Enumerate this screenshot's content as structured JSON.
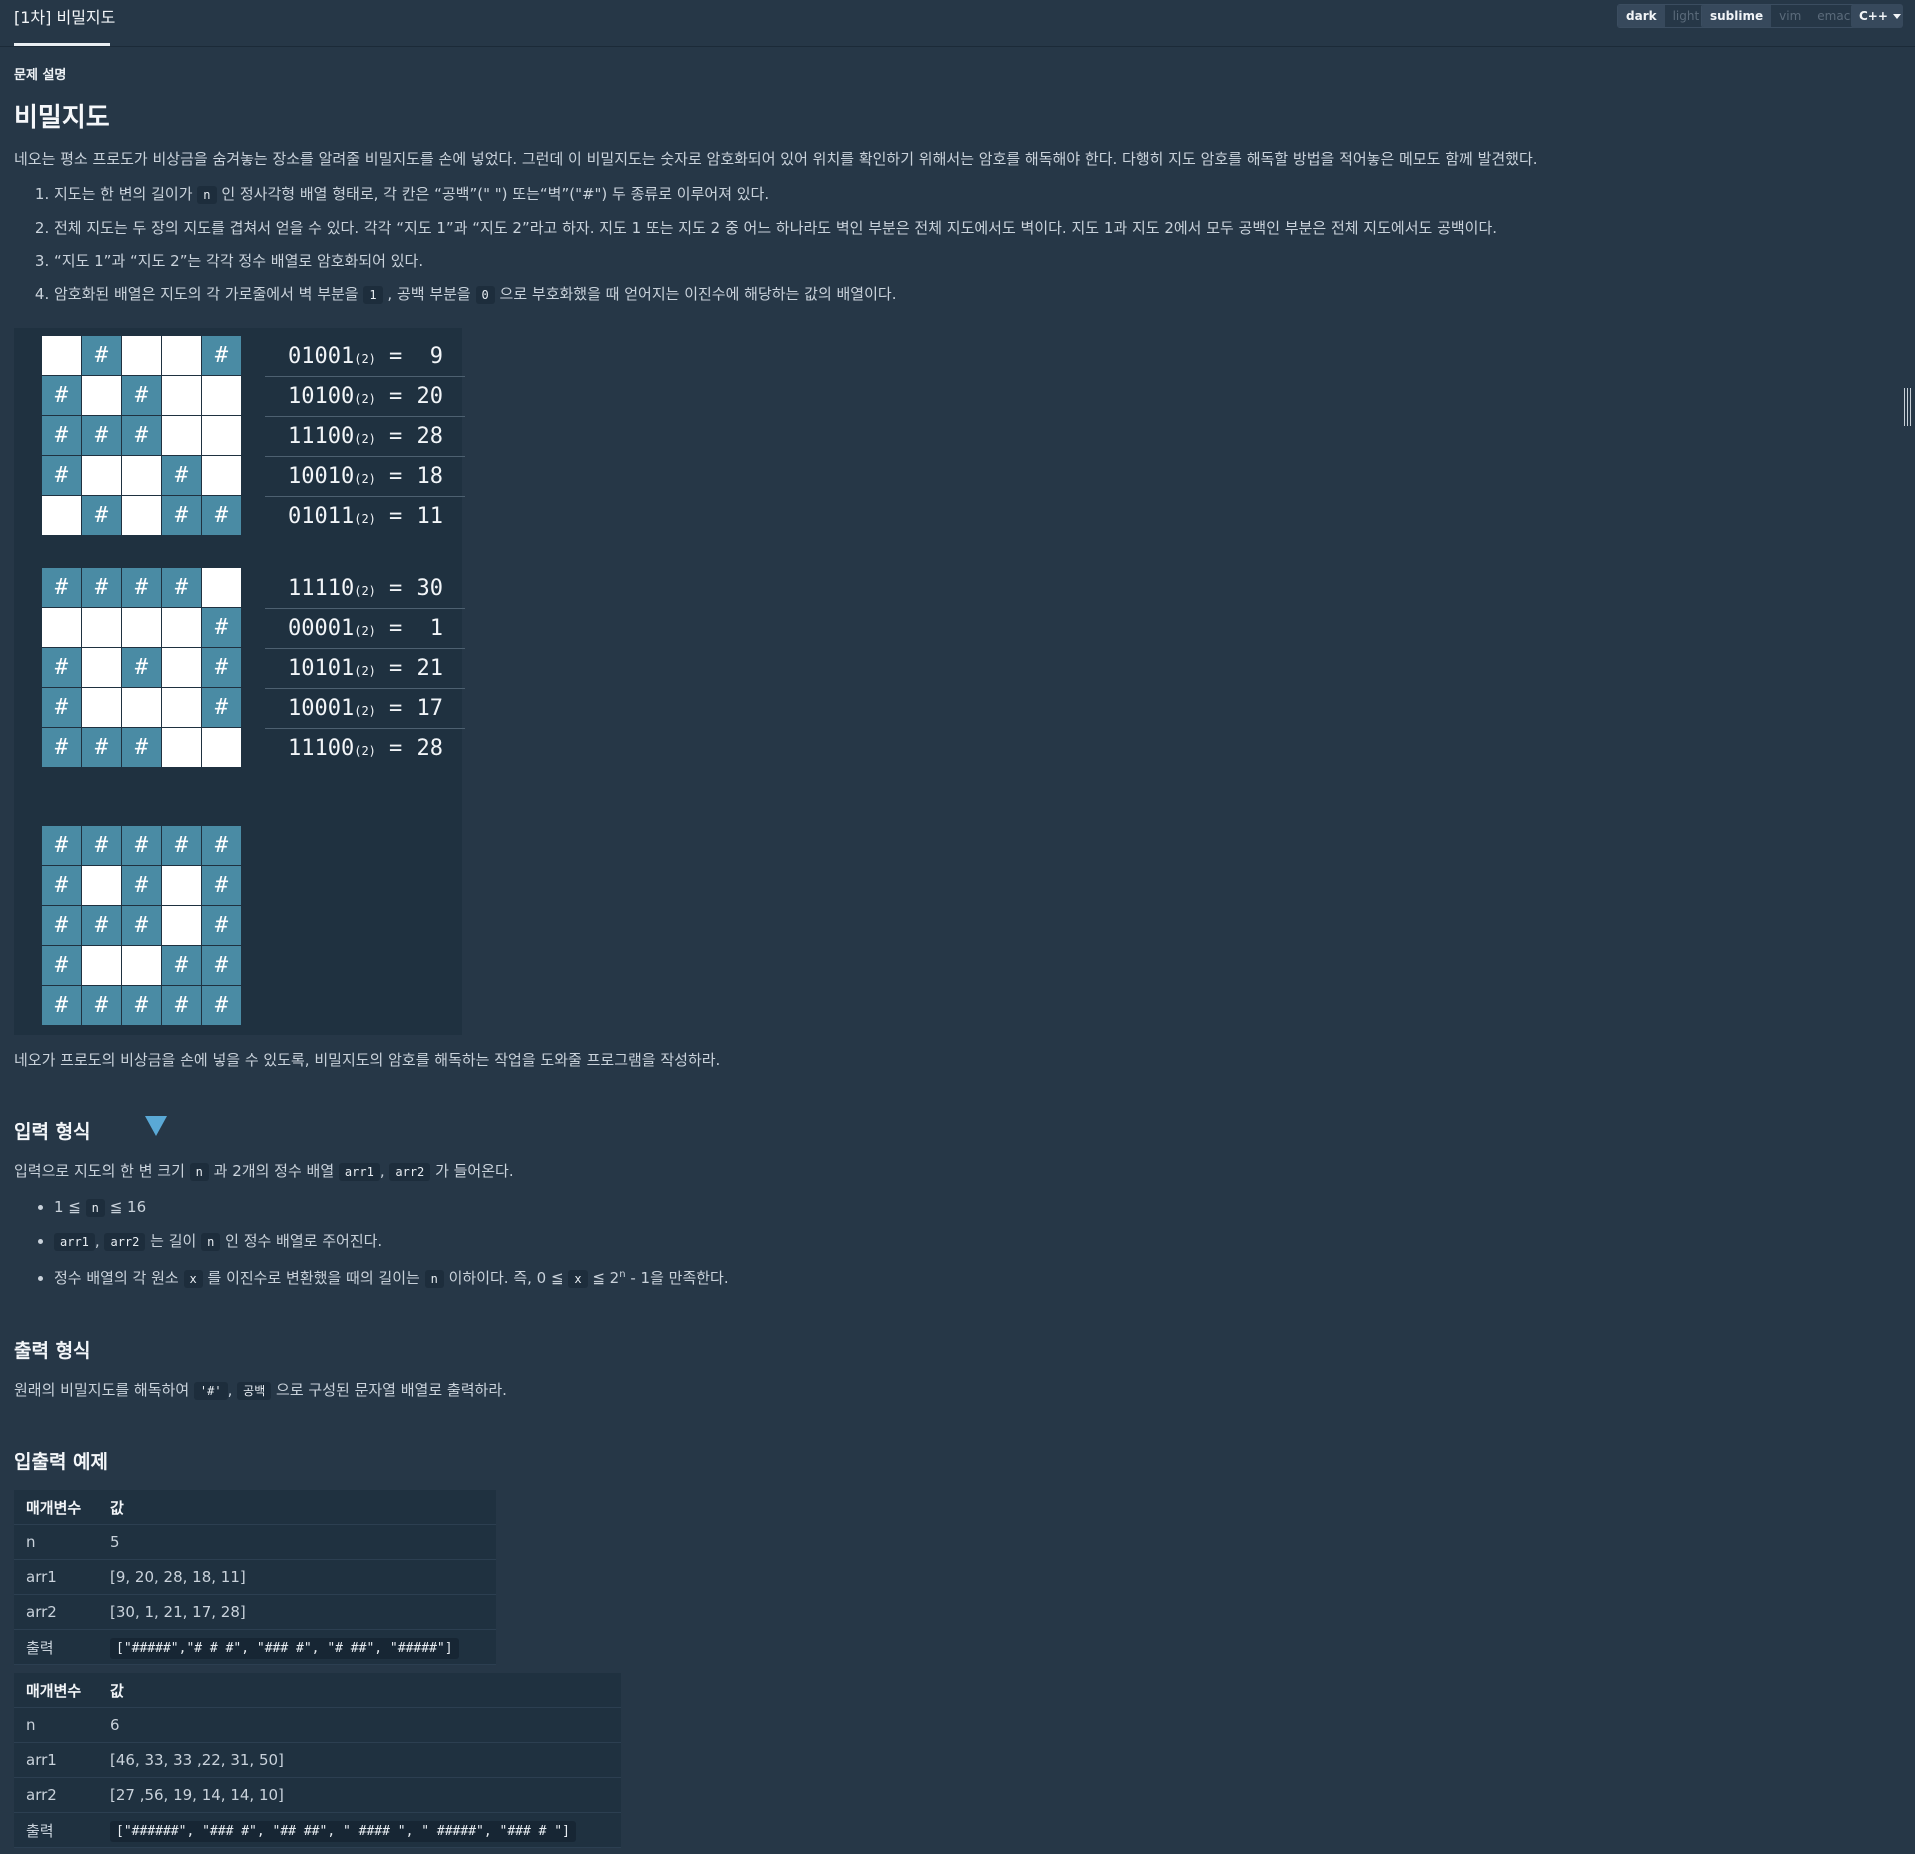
{
  "header": {
    "tab_title": "[1차] 비밀지도",
    "theme_options": [
      "dark",
      "light"
    ],
    "theme_selected": "dark",
    "keymap_options": [
      "sublime",
      "vim",
      "emacs"
    ],
    "keymap_selected": "sublime",
    "language": "C++"
  },
  "problem": {
    "section_label": "문제 설명",
    "title": "비밀지도",
    "intro": "네오는 평소 프로도가 비상금을 숨겨놓는 장소를 알려줄 비밀지도를 손에 넣었다. 그런데 이 비밀지도는 숫자로 암호화되어 있어 위치를 확인하기 위해서는 암호를 해독해야 한다. 다행히 지도 암호를 해독할 방법을 적어놓은 메모도 함께 발견했다.",
    "rules": {
      "r1_a": "지도는 한 변의 길이가",
      "r1_code": "n",
      "r1_b": "인 정사각형 배열 형태로, 각 칸은 “공백”(\" \") 또는“벽”(\"#\") 두 종류로 이루어져 있다.",
      "r2": "전체 지도는 두 장의 지도를 겹쳐서 얻을 수 있다. 각각 “지도 1”과 “지도 2”라고 하자. 지도 1 또는 지도 2 중 어느 하나라도 벽인 부분은 전체 지도에서도 벽이다. 지도 1과 지도 2에서 모두 공백인 부분은 전체 지도에서도 공백이다.",
      "r3": "“지도 1”과 “지도 2”는 각각 정수 배열로 암호화되어 있다.",
      "r4_a": "암호화된 배열은 지도의 각 가로줄에서 벽 부분을",
      "r4_code1": "1",
      "r4_b": ", 공백 부분을",
      "r4_code2": "0",
      "r4_c": "으로 부호화했을 때 얻어지는 이진수에 해당하는 값의 배열이다."
    },
    "figure": {
      "map1": [
        "01001",
        "10100",
        "11100",
        "10010",
        "01011"
      ],
      "map1_values": [
        "9",
        "20",
        "28",
        "18",
        "11"
      ],
      "map2": [
        "11110",
        "00001",
        "10101",
        "10001",
        "11100"
      ],
      "map2_values": [
        "30",
        "1",
        "21",
        "17",
        "28"
      ],
      "result": [
        "11111",
        "10101",
        "11101",
        "10011",
        "11111"
      ],
      "wall_symbol": "#",
      "base_label": "(2)",
      "equals": "="
    },
    "conclusion": "네오가 프로도의 비상금을 손에 넣을 수 있도록, 비밀지도의 암호를 해독하는 작업을 도와줄 프로그램을 작성하라."
  },
  "input_format": {
    "title": "입력 형식",
    "desc_a": "입력으로 지도의 한 변 크기",
    "desc_code_n": "n",
    "desc_b": "과 2개의 정수 배열",
    "desc_code_arr1": "arr1",
    "desc_sep": ",",
    "desc_code_arr2": "arr2",
    "desc_c": "가 들어온다.",
    "b1_a": "1 ≦",
    "b1_code": "n",
    "b1_b": "≦ 16",
    "b2_code1": "arr1",
    "b2_sep": ",",
    "b2_code2": "arr2",
    "b2_a": "는 길이",
    "b2_code3": "n",
    "b2_b": "인 정수 배열로 주어진다.",
    "b3_a": "정수 배열의 각 원소",
    "b3_code1": "x",
    "b3_b": "를 이진수로 변환했을 때의 길이는",
    "b3_code2": "n",
    "b3_c": "이하이다. 즉, 0 ≦",
    "b3_code3": "x",
    "b3_d": "≦ 2",
    "b3_sup": "n",
    "b3_e": " - 1을 만족한다."
  },
  "output_format": {
    "title": "출력 형식",
    "desc_a": "원래의 비밀지도를 해독하여",
    "desc_code1": "'#'",
    "desc_sep": ",",
    "desc_code2": "공백",
    "desc_b": "으로 구성된 문자열 배열로 출력하라."
  },
  "examples": {
    "title": "입출력 예제",
    "header_param": "매개변수",
    "header_value": "값",
    "tables": [
      {
        "rows": [
          {
            "k": "n",
            "v": "5"
          },
          {
            "k": "arr1",
            "v": "[9, 20, 28, 18, 11]"
          },
          {
            "k": "arr2",
            "v": "[30, 1, 21, 17, 28]"
          }
        ],
        "out_label": "출력",
        "out": "[\"#####\",\"# # #\", \"### #\", \"# ##\", \"#####\"]"
      },
      {
        "rows": [
          {
            "k": "n",
            "v": "6"
          },
          {
            "k": "arr1",
            "v": "[46, 33, 33 ,22, 31, 50]"
          },
          {
            "k": "arr2",
            "v": "[27 ,56, 19, 14, 14, 10]"
          }
        ],
        "out_label": "출력",
        "out": "[\"######\", \"### #\", \"## ##\", \" #### \", \" #####\", \"### # \"]"
      }
    ]
  }
}
